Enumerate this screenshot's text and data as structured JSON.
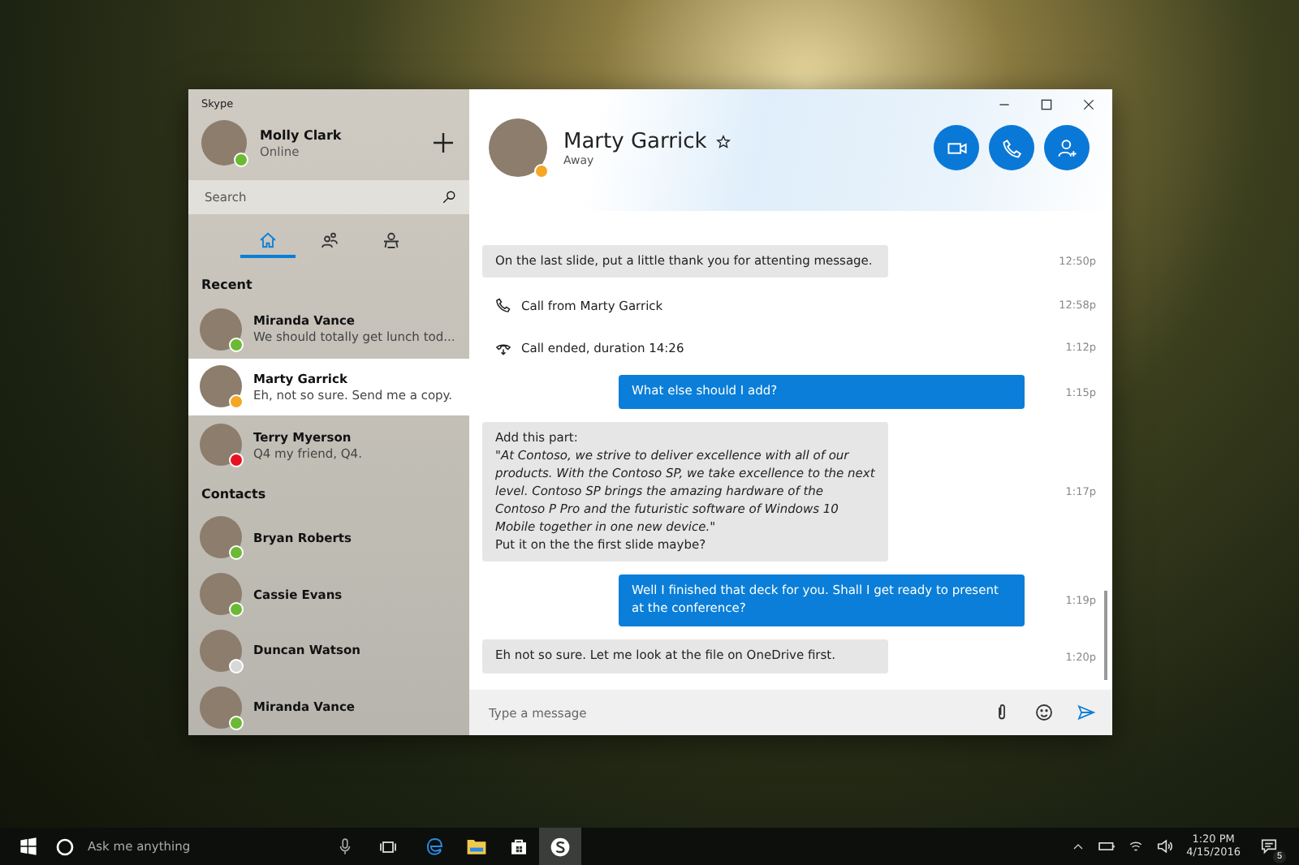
{
  "window": {
    "title": "Skype"
  },
  "profile": {
    "name": "Molly Clark",
    "status": "Online",
    "color": "#6bb934"
  },
  "search": {
    "placeholder": "Search"
  },
  "nav_tabs": [
    {
      "selected": true
    },
    {
      "selected": false
    },
    {
      "selected": false
    }
  ],
  "recent": {
    "heading": "Recent",
    "items": [
      {
        "name": "Miranda Vance",
        "preview": "We should totally get lunch tod...",
        "color": "#6bb934",
        "selected": false
      },
      {
        "name": "Marty Garrick",
        "preview": "Eh, not so sure. Send me a copy.",
        "color": "#f5a623",
        "selected": true
      },
      {
        "name": "Terry Myerson",
        "preview": "Q4 my friend, Q4.",
        "color": "#e81123",
        "selected": false
      }
    ]
  },
  "contacts": {
    "heading": "Contacts",
    "items": [
      {
        "name": "Bryan Roberts",
        "color": "#6bb934"
      },
      {
        "name": "Cassie Evans",
        "color": "#6bb934"
      },
      {
        "name": "Duncan Watson",
        "color": "#d8d8d8"
      },
      {
        "name": "Miranda Vance",
        "color": "#6bb934"
      }
    ]
  },
  "chat": {
    "name": "Marty Garrick",
    "status": "Away",
    "color": "#f5a623",
    "favorite": true,
    "messages": [
      {
        "kind": "received",
        "text": "On the last slide, put a little thank you for attenting message.",
        "time": "12:50p"
      },
      {
        "kind": "call",
        "text": "Call from Marty Garrick",
        "time": "12:58p"
      },
      {
        "kind": "call-ended",
        "text": "Call ended, duration 14:26",
        "time": "1:12p"
      },
      {
        "kind": "sent",
        "text": "What else should I add?",
        "time": "1:15p"
      },
      {
        "kind": "received",
        "text": "Add this part:\n*\"At Contoso, we strive to deliver excellence with all of our products. With the Contoso SP, we take excellence to the next level. Contoso SP brings the amazing hardware of the Contoso P Pro and the futuristic software of Windows 10 Mobile together in one new device.\"*\nPut it on the the first slide maybe?",
        "time": "1:17p"
      },
      {
        "kind": "sent",
        "text": "Well I finished that deck for you. Shall I get ready to present at the conference?",
        "time": "1:19p"
      },
      {
        "kind": "received",
        "text": "Eh not so sure. Let me look at the file on OneDrive first.",
        "time": "1:20p"
      }
    ],
    "input": {
      "placeholder": "Type a message"
    }
  },
  "taskbar": {
    "search_placeholder": "Ask me anything",
    "time": "1:20 PM",
    "date": "4/15/2016",
    "notification_count": "5",
    "apps": [
      {
        "kind": "edge",
        "active": false
      },
      {
        "kind": "explorer",
        "active": false
      },
      {
        "kind": "store",
        "active": false
      },
      {
        "kind": "skype",
        "active": true
      }
    ]
  }
}
